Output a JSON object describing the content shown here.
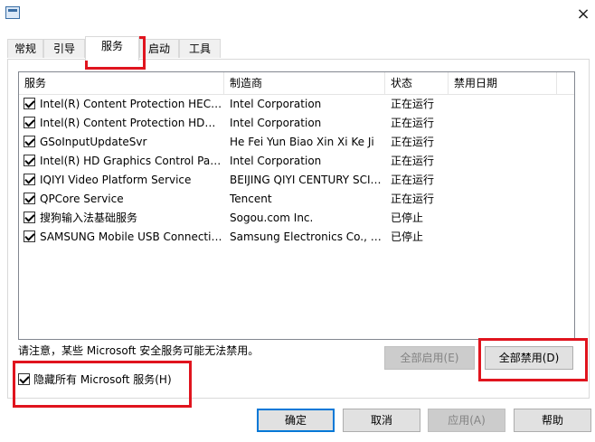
{
  "dialog": {
    "close_glyph": "×"
  },
  "tabs": [
    {
      "label": "常规"
    },
    {
      "label": "引导"
    },
    {
      "label": "服务"
    },
    {
      "label": "启动"
    },
    {
      "label": "工具"
    }
  ],
  "columns": [
    "服务",
    "制造商",
    "状态",
    "禁用日期"
  ],
  "services": [
    {
      "name": "Intel(R) Content Protection HECI Service",
      "vendor": "Intel Corporation",
      "status": "正在运行",
      "disabled_date": "",
      "checked": true
    },
    {
      "name": "Intel(R) Content Protection HDCP Service",
      "vendor": "Intel Corporation",
      "status": "正在运行",
      "disabled_date": "",
      "checked": true
    },
    {
      "name": "GSoInputUpdateSvr",
      "vendor": "He Fei Yun Biao Xin Xi Ke Ji",
      "status": "正在运行",
      "disabled_date": "",
      "checked": true
    },
    {
      "name": "Intel(R) HD Graphics Control Panel Service",
      "vendor": "Intel Corporation",
      "status": "正在运行",
      "disabled_date": "",
      "checked": true
    },
    {
      "name": "IQIYI Video Platform Service",
      "vendor": "BEIJING QIYI CENTURY SCIENCE",
      "status": "正在运行",
      "disabled_date": "",
      "checked": true
    },
    {
      "name": "QPCore Service",
      "vendor": "Tencent",
      "status": "正在运行",
      "disabled_date": "",
      "checked": true
    },
    {
      "name": "搜狗输入法基础服务",
      "vendor": "Sogou.com Inc.",
      "status": "已停止",
      "disabled_date": "",
      "checked": true
    },
    {
      "name": "SAMSUNG Mobile USB Connectivity Service",
      "vendor": "Samsung Electronics Co., Ltd.",
      "status": "已停止",
      "disabled_date": "",
      "checked": true
    }
  ],
  "note": "请注意，某些 Microsoft 安全服务可能无法禁用。",
  "enable_all_label": "全部启用(E)",
  "disable_all_label": "全部禁用(D)",
  "hide_ms_label": "隐藏所有 Microsoft 服务(H)",
  "hide_ms_checked": true,
  "footer": {
    "ok_label": "确定",
    "cancel_label": "取消",
    "apply_label": "应用(A)",
    "help_label": "帮助"
  },
  "highlight_color": "#e0141e",
  "accent_color": "#0078d7"
}
